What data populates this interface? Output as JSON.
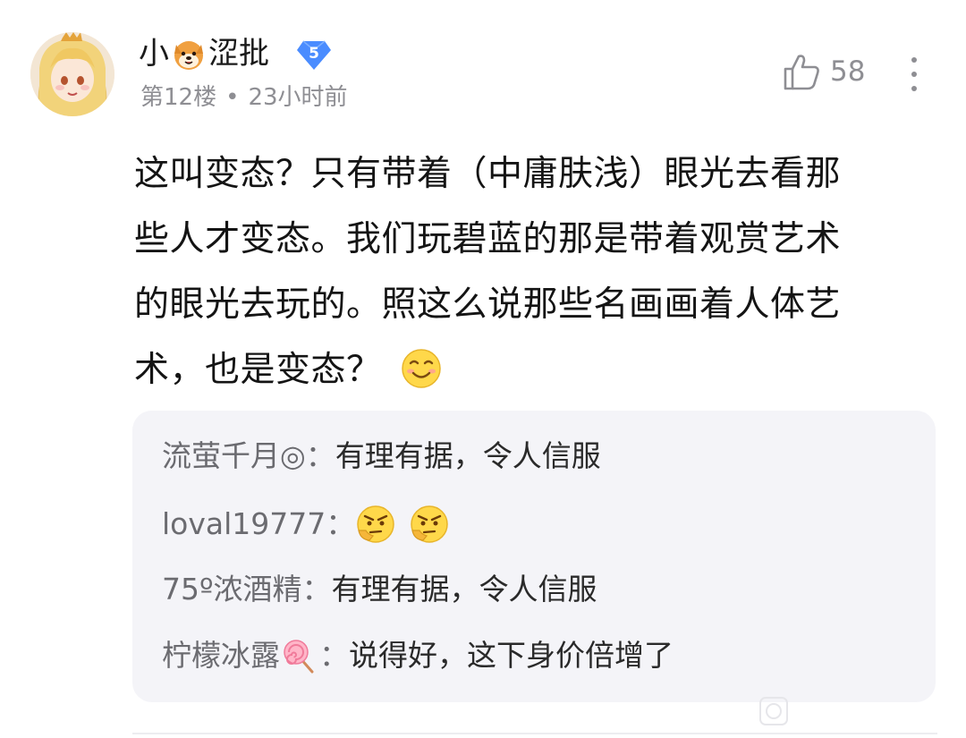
{
  "comment": {
    "user": {
      "name_part1": "小",
      "name_emoji": "shiba-dog-emoji",
      "name_part2": "涩批",
      "level": "5"
    },
    "meta": {
      "floor": "第12楼",
      "separator": "•",
      "time": "23小时前"
    },
    "likes": "58",
    "text_lines": [
      "这叫变态？只有带着（中庸肤浅）眼光去看那",
      "些人才变态。我们玩碧蓝的那是带着观赏艺术",
      "的眼光去玩的。照这么说那些名画画着人体艺",
      "术，也是变态？"
    ],
    "text_emoji": "smile-emoji"
  },
  "replies": [
    {
      "author": "流萤千月◎",
      "colon": "：",
      "text": "有理有据，令人信服"
    },
    {
      "author": "loval19777",
      "colon": "：",
      "text": "",
      "emojis": [
        "thinking-emoji",
        "thinking-emoji"
      ]
    },
    {
      "author": "75º浓酒精",
      "colon": "：",
      "text": "有理有据，令人信服"
    },
    {
      "author": "柠檬冰露",
      "author_emoji": "lollipop-emoji",
      "colon": "：",
      "text": "说得好，这下身价倍增了"
    }
  ],
  "colors": {
    "secondary_text": "#8e8e93",
    "reply_bg": "#f4f4f8",
    "badge_blue": "#4a8cff"
  }
}
